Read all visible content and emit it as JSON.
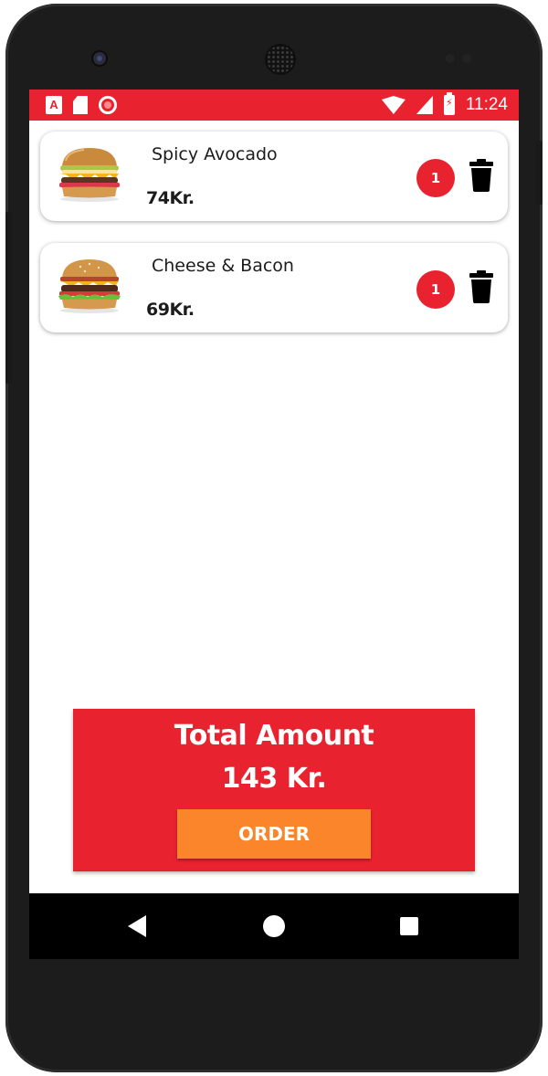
{
  "status_bar": {
    "time": "11:24",
    "left_icons": [
      "app-a-icon",
      "sd-card-icon",
      "record-icon"
    ],
    "right_icons": [
      "wifi-icon",
      "signal-icon",
      "battery-charging-icon"
    ],
    "color": "#e8232f"
  },
  "cart": {
    "items": [
      {
        "name": "Spicy Avocado",
        "price": "74Kr.",
        "quantity": "1",
        "image_icon": "burger-image",
        "delete_icon": "trash-icon"
      },
      {
        "name": "Cheese & Bacon",
        "price": "69Kr.",
        "quantity": "1",
        "image_icon": "burger-image",
        "delete_icon": "trash-icon"
      }
    ]
  },
  "total": {
    "label": "Total Amount",
    "value": "143 Kr.",
    "order_label": "ORDER"
  },
  "nav_bar": {
    "icons": [
      "back-icon",
      "home-icon",
      "recents-icon"
    ]
  },
  "colors": {
    "accent_red": "#e8232f",
    "order_orange": "#fb852b",
    "text_dark": "#1c1c1c"
  }
}
